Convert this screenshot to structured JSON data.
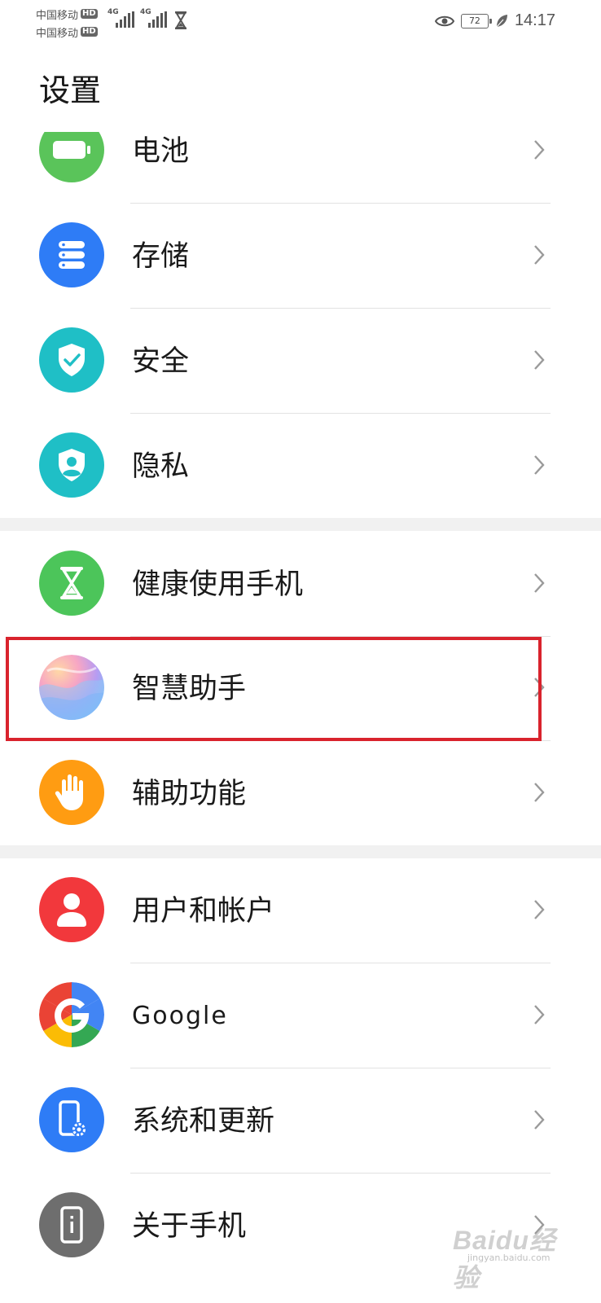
{
  "status_bar": {
    "carrier1": "中国移动",
    "carrier2": "中国移动",
    "hd": "HD",
    "net1": "4G",
    "net2": "4G",
    "battery": "72",
    "time": "14:17"
  },
  "title": "设置",
  "items": [
    {
      "label": "电池",
      "icon": "battery-icon",
      "color": "#5ac45a"
    },
    {
      "label": "存储",
      "icon": "storage-icon",
      "color": "#2e7cf6"
    },
    {
      "label": "安全",
      "icon": "shield-check-icon",
      "color": "#1fbfc6"
    },
    {
      "label": "隐私",
      "icon": "privacy-icon",
      "color": "#1fbfc6"
    },
    {
      "label": "健康使用手机",
      "icon": "hourglass-icon",
      "color": "#4cc55a"
    },
    {
      "label": "智慧助手",
      "icon": "assistant-icon",
      "color": "#b89cf0"
    },
    {
      "label": "辅助功能",
      "icon": "hand-icon",
      "color": "#ff9c12"
    },
    {
      "label": "用户和帐户",
      "icon": "user-icon",
      "color": "#f2383c"
    },
    {
      "label": "Google",
      "icon": "google-icon",
      "color": "#4285f4"
    },
    {
      "label": "系统和更新",
      "icon": "phone-settings-icon",
      "color": "#2e7cf6"
    },
    {
      "label": "关于手机",
      "icon": "phone-info-icon",
      "color": "#6e6e6e"
    }
  ],
  "watermark": {
    "text": "Baidu经验",
    "sub": "jingyan.baidu.com"
  }
}
